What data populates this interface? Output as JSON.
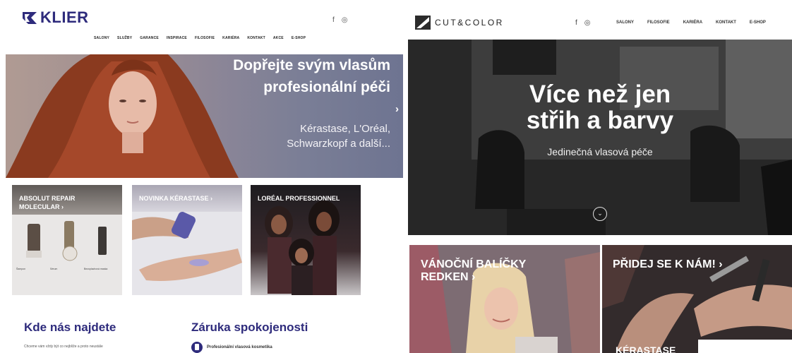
{
  "klier": {
    "logo": "KLIER",
    "social": {
      "facebook": "f",
      "instagram": "◎"
    },
    "nav": [
      "SALONY",
      "SLUŽBY",
      "GARANCE",
      "INSPIRACE",
      "FILOSOFIE",
      "KARIÉRA",
      "KONTAKT",
      "AKCE",
      "E-SHOP"
    ],
    "hero": {
      "title_line1": "Dopřejte svým vlasům",
      "title_line2": "profesionální péči",
      "sub_line1": "Kérastase, L'Oréal,",
      "sub_line2": "Schwarzkopf a další...",
      "arrow": "›"
    },
    "cards": [
      {
        "title_line1": "ABSOLUT REPAIR",
        "title_line2": "MOLECULAR ›"
      },
      {
        "title_line1": "NOVINKA KÉRASTASE ›",
        "title_line2": ""
      },
      {
        "title_line1": "LORÉAL PROFESSIONNEL",
        "title_line2": ""
      }
    ],
    "product_labels": [
      "Šampon",
      "Sérum",
      "Bezoplachová maska"
    ],
    "find": {
      "heading": "Kde nás najdete",
      "text": "Chceme vám vždy být co nejblíže a proto neustále"
    },
    "guarantee": {
      "heading": "Záruka spokojenosti",
      "item": "Profesionální vlasová kosmetika"
    },
    "colors": {
      "brand": "#2e2b7c"
    }
  },
  "cutcolor": {
    "logo": "CUT&COLOR",
    "social": {
      "facebook": "f",
      "instagram": "◎"
    },
    "nav": [
      "SALONY",
      "FILOSOFIE",
      "KARIÉRA",
      "KONTAKT",
      "E-SHOP"
    ],
    "hero": {
      "title_line1": "Více než jen",
      "title_line2": "střih a barvy",
      "subtitle": "Jedinečná vlasová péče",
      "scroll_icon": "⌄"
    },
    "tiles": [
      {
        "title_line1": "VÁNOČNÍ BALÍČKY",
        "title_line2": "REDKEN ›"
      },
      {
        "title_line1": "PŘIDEJ SE K NÁM! ›",
        "title_line2": ""
      }
    ],
    "tile3_label": "KÉRASTASE"
  }
}
